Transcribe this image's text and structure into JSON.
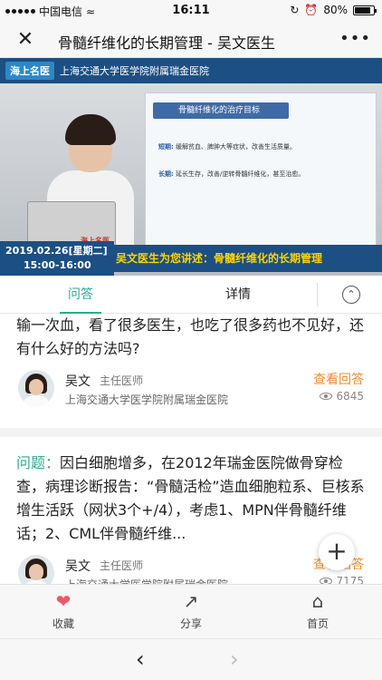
{
  "status_bar": {
    "carrier": "中国电信",
    "time": "16:11",
    "battery": "80%"
  },
  "nav": {
    "title": "骨髓纤维化的长期管理 - 吴文医生"
  },
  "video": {
    "brand_logo": "海上名医",
    "hospital_name": "上海交通大学医学院附属瑞金医院",
    "slide_title": "骨髓纤维化的治疗目标",
    "slide_short_label": "短期:",
    "slide_short_text": "缓解贫血、脾肿大等症状，改善生活质量。",
    "slide_long_label": "长期:",
    "slide_long_text": "延长生存，改善/逆转骨髓纤维化，甚至治愈。",
    "laptop_logo": "海上名医",
    "date": "2019.02.26[星期二]",
    "time_range": "15:00-16:00",
    "caption": "吴文医生为您讲述：骨髓纤维化的长期管理"
  },
  "tabs": {
    "qa": "问答",
    "detail": "详情"
  },
  "qa_list": {
    "q1_text": "输一次血，看了很多医生，也吃了很多药也不见好，还有什么好的方法吗?",
    "q1_doctor": "吴文",
    "q1_title": "主任医师",
    "q1_hospital": "上海交通大学医学院附属瑞金医院",
    "q1_action": "查看回答",
    "q1_views": "6845",
    "q2_label": "问题：",
    "q2_text": "因白细胞增多，在2012年瑞金医院做骨穿检查，病理诊断报告：“骨髓活检”造血细胞粒系、巨核系增生活跃（网状3个+/4），考虑1、MPN伴骨髓纤维话；2、CML伴骨髓纤维...",
    "q2_doctor": "吴文",
    "q2_title": "主任医师",
    "q2_hospital": "上海交通大学医学院附属瑞金医院",
    "q2_action": "查看回答",
    "q2_views": "7175"
  },
  "bottom_bar": {
    "favorite": "收藏",
    "share": "分享",
    "home": "首页"
  },
  "colors": {
    "accent": "#2eaa8f",
    "orange": "#f08c2d",
    "heart": "#e95b6b"
  }
}
